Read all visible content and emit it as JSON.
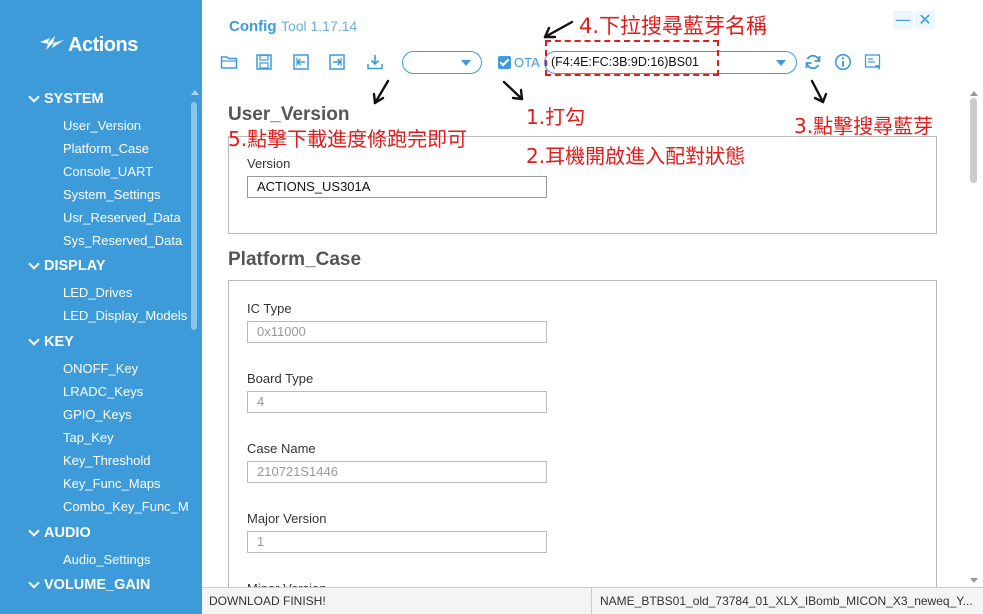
{
  "app": {
    "name_bold": "Config",
    "name_rest": "Tool 1.17.14",
    "logo_text": "Actions"
  },
  "window": {
    "minimize": "—",
    "close": "✕"
  },
  "toolbar": {
    "ota_label": "OTA",
    "ota_checked": true,
    "device_select_value": "(F4:4E:FC:3B:9D:16)BS01",
    "icons": [
      "folder-open-icon",
      "save-icon",
      "import-icon",
      "export-icon",
      "download-icon",
      "refresh-icon",
      "info-icon",
      "ota-settings-icon"
    ]
  },
  "sidebar": {
    "sections": [
      {
        "title": "SYSTEM",
        "items": [
          "User_Version",
          "Platform_Case",
          "Console_UART",
          "System_Settings",
          "Usr_Reserved_Data",
          "Sys_Reserved_Data"
        ]
      },
      {
        "title": "DISPLAY",
        "items": [
          "LED_Drives",
          "LED_Display_Models"
        ]
      },
      {
        "title": "KEY",
        "items": [
          "ONOFF_Key",
          "LRADC_Keys",
          "GPIO_Keys",
          "Tap_Key",
          "Key_Threshold",
          "Key_Func_Maps",
          "Combo_Key_Func_M"
        ]
      },
      {
        "title": "AUDIO",
        "items": [
          "Audio_Settings"
        ]
      },
      {
        "title": "VOLUME_GAIN",
        "items": []
      }
    ]
  },
  "content": {
    "user_version": {
      "title": "User_Version",
      "version_label": "Version",
      "version_value": "ACTIONS_US301A"
    },
    "platform_case": {
      "title": "Platform_Case",
      "fields": [
        {
          "label": "IC  Type",
          "value": "0x11000"
        },
        {
          "label": "Board  Type",
          "value": "4"
        },
        {
          "label": "Case  Name",
          "value": "210721S1446"
        },
        {
          "label": "Major  Version",
          "value": "1"
        },
        {
          "label": "Minor  Version",
          "value": ""
        }
      ]
    }
  },
  "status": {
    "left": "DOWNLOAD FINISH!",
    "right": "NAME_BTBS01_old_73784_01_XLX_IBomb_MICON_X3_neweq_Y..."
  },
  "annotations": {
    "step1": "1.打勾",
    "step2": "2.耳機開啟進入配對狀態",
    "step3": "3.點擊搜尋藍芽",
    "step4": "4.下拉搜尋藍芽名稱",
    "step5": "5.點擊下載進度條跑完即可"
  },
  "colors": {
    "accent": "#3d9bd9",
    "annotation_red": "#e01c1c",
    "section_heading": "#555555"
  }
}
